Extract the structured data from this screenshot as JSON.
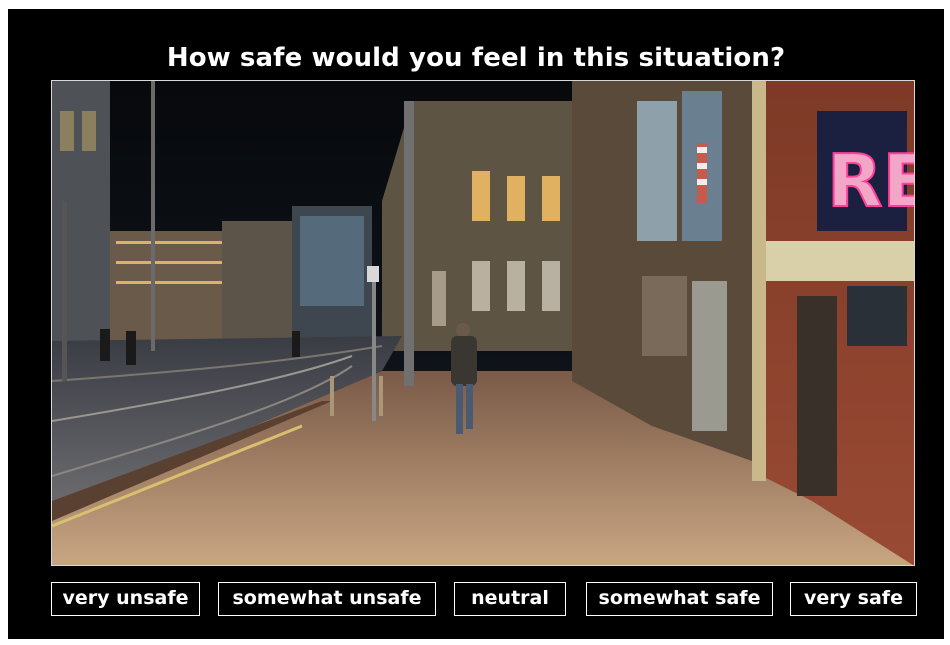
{
  "survey": {
    "question": "How safe would you feel in this situation?",
    "scene": {
      "description_icon": "street-photo",
      "sign_letters": "RE"
    },
    "options": [
      "very unsafe",
      "somewhat unsafe",
      "neutral",
      "somewhat safe",
      "very safe"
    ]
  },
  "colors": {
    "background": "#000000",
    "text": "#ffffff",
    "button_border": "#ffffff"
  }
}
